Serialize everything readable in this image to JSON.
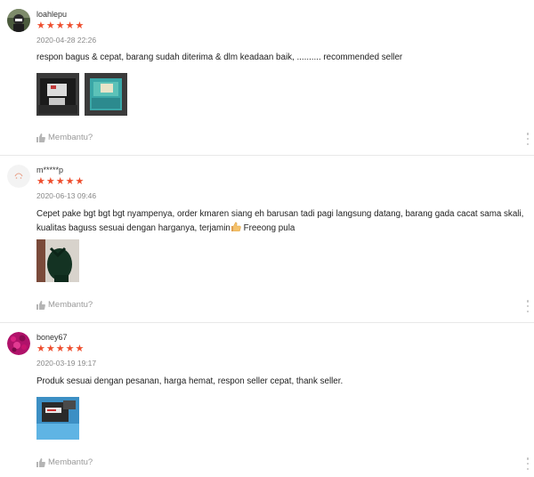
{
  "reviews": [
    {
      "author": "loahlepu",
      "stars": "★★★★★",
      "date": "2020-04-28 22:26",
      "comment": "respon bagus & cepat, barang sudah diterima & dlm keadaan baik, .......... recommended seller",
      "helpful": "Membantu?"
    },
    {
      "author": "m*****p",
      "stars": "★★★★★",
      "date": "2020-06-13 09:46",
      "comment_a": "Cepet pake bgt bgt bgt nyampenya, order kmaren siang eh barusan tadi pagi langsung datang, barang gada cacat sama skali, kualitas baguss sesuai dengan harganya, terjamin",
      "comment_b": " Freeong pula",
      "emoji": "thumbs-up-emoji",
      "helpful": "Membantu?"
    },
    {
      "author": "boney67",
      "stars": "★★★★★",
      "date": "2020-03-19 19:17",
      "comment": "Produk sesuai dengan pesanan, harga hemat, respon seller cepat, thank seller.",
      "helpful": "Membantu?"
    }
  ],
  "icons": {
    "helpful": "thumbs-up-icon",
    "more": "more-vertical-icon"
  },
  "colors": {
    "star": "#ee4d2d",
    "muted": "#9a9a9a",
    "divider": "#e8e8e8"
  }
}
